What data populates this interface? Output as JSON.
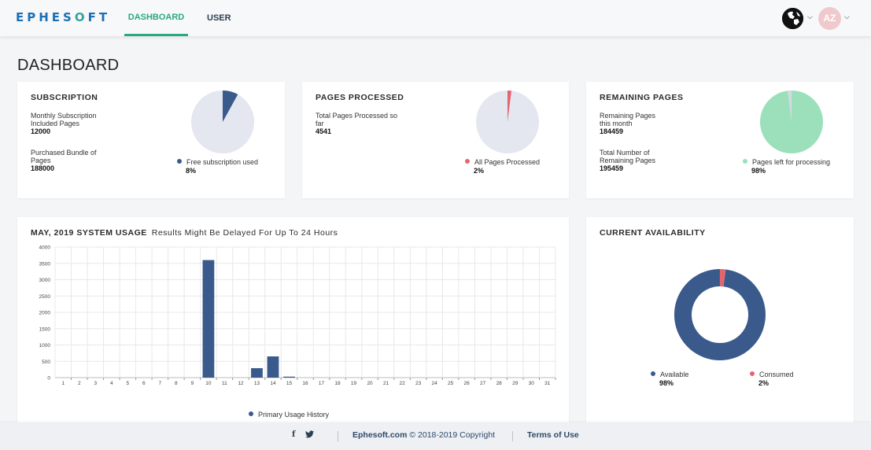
{
  "header": {
    "logo": "EPHESOFT",
    "tabs": [
      {
        "label": "DASHBOARD",
        "active": true
      },
      {
        "label": "USER",
        "active": false
      }
    ],
    "avatar_initials": "AZ",
    "globe_icon": "globe-icon"
  },
  "page_title": "DASHBOARD",
  "cards": {
    "subscription": {
      "title": "SUBSCRIPTION",
      "stats": [
        {
          "label": "Monthly Subscription Included Pages",
          "value": "12000"
        },
        {
          "label": "Purchased Bundle of Pages",
          "value": "188000"
        }
      ],
      "legend": {
        "label": "Free subscription used",
        "pct": "8%",
        "color": "#3a5a8c"
      },
      "pie": {
        "used_fraction": 0.08,
        "used_color": "#3a5a8c",
        "rest_color": "#e4e7f0"
      }
    },
    "pages_processed": {
      "title": "PAGES PROCESSED",
      "stats": [
        {
          "label": "Total Pages Processed so far",
          "value": "4541"
        }
      ],
      "legend": {
        "label": "All Pages Processed",
        "pct": "2%",
        "color": "#e4656e"
      },
      "pie": {
        "used_fraction": 0.02,
        "used_color": "#e4656e",
        "rest_color": "#e4e7f0"
      }
    },
    "remaining_pages": {
      "title": "REMAINING PAGES",
      "stats": [
        {
          "label": "Remaining Pages this month",
          "value": "184459"
        },
        {
          "label": "Total Number of Remaining Pages",
          "value": "195459"
        }
      ],
      "legend": {
        "label": "Pages left for processing",
        "pct": "98%",
        "color": "#9be0bb"
      },
      "pie": {
        "used_fraction": 0.02,
        "used_color": "#d4dbe0",
        "rest_color": "#9be0bb"
      }
    },
    "usage": {
      "title": "MAY, 2019 SYSTEM USAGE",
      "subtitle": "Results Might Be Delayed For Up To 24 Hours",
      "legend": "Primary Usage History",
      "color": "#3a5a8c"
    },
    "availability": {
      "title": "CURRENT AVAILABILITY",
      "legend": [
        {
          "label": "Available",
          "pct": "98%",
          "color": "#3a5a8c"
        },
        {
          "label": "Consumed",
          "pct": "2%",
          "color": "#e4656e"
        }
      ],
      "consumed_fraction": 0.02
    }
  },
  "chart_data": {
    "type": "bar",
    "categories": [
      "1",
      "2",
      "3",
      "4",
      "5",
      "6",
      "7",
      "8",
      "9",
      "10",
      "11",
      "12",
      "13",
      "14",
      "15",
      "16",
      "17",
      "18",
      "19",
      "20",
      "21",
      "22",
      "23",
      "24",
      "25",
      "26",
      "27",
      "28",
      "29",
      "30",
      "31"
    ],
    "series": [
      {
        "name": "Primary Usage History",
        "values": [
          0,
          0,
          0,
          0,
          0,
          0,
          0,
          0,
          0,
          3600,
          0,
          0,
          290,
          650,
          30,
          0,
          0,
          0,
          0,
          0,
          0,
          0,
          0,
          0,
          0,
          0,
          0,
          0,
          0,
          0,
          0
        ]
      }
    ],
    "yticks": [
      "0",
      "500",
      "1000",
      "1500",
      "2000",
      "2500",
      "3000",
      "3500",
      "4000"
    ],
    "ylim": [
      0,
      4000
    ],
    "grid": true,
    "legend_position": "bottom"
  },
  "footer": {
    "facebook_icon": "f",
    "twitter_icon": "twitter-icon",
    "site": "Ephesoft.com",
    "copyright": "© 2018-2019 Copyright",
    "terms": "Terms of Use"
  }
}
